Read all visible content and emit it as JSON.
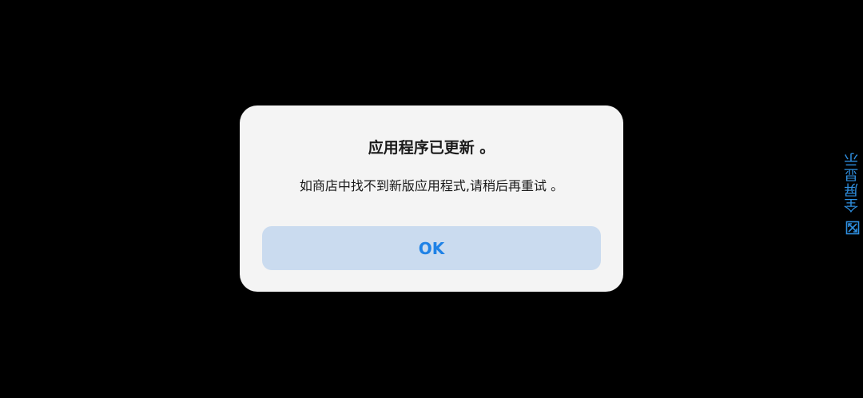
{
  "dialog": {
    "title": "应用程序已更新 。",
    "message": "如商店中找不到新版应用程式,请稍后再重试 。",
    "ok_label": "OK"
  },
  "fullscreen": {
    "label": "全屏显示",
    "icon": "expand-icon"
  },
  "colors": {
    "background": "#000000",
    "dialog_bg": "#f4f4f4",
    "button_bg": "#cadbef",
    "accent": "#1f82e6"
  }
}
